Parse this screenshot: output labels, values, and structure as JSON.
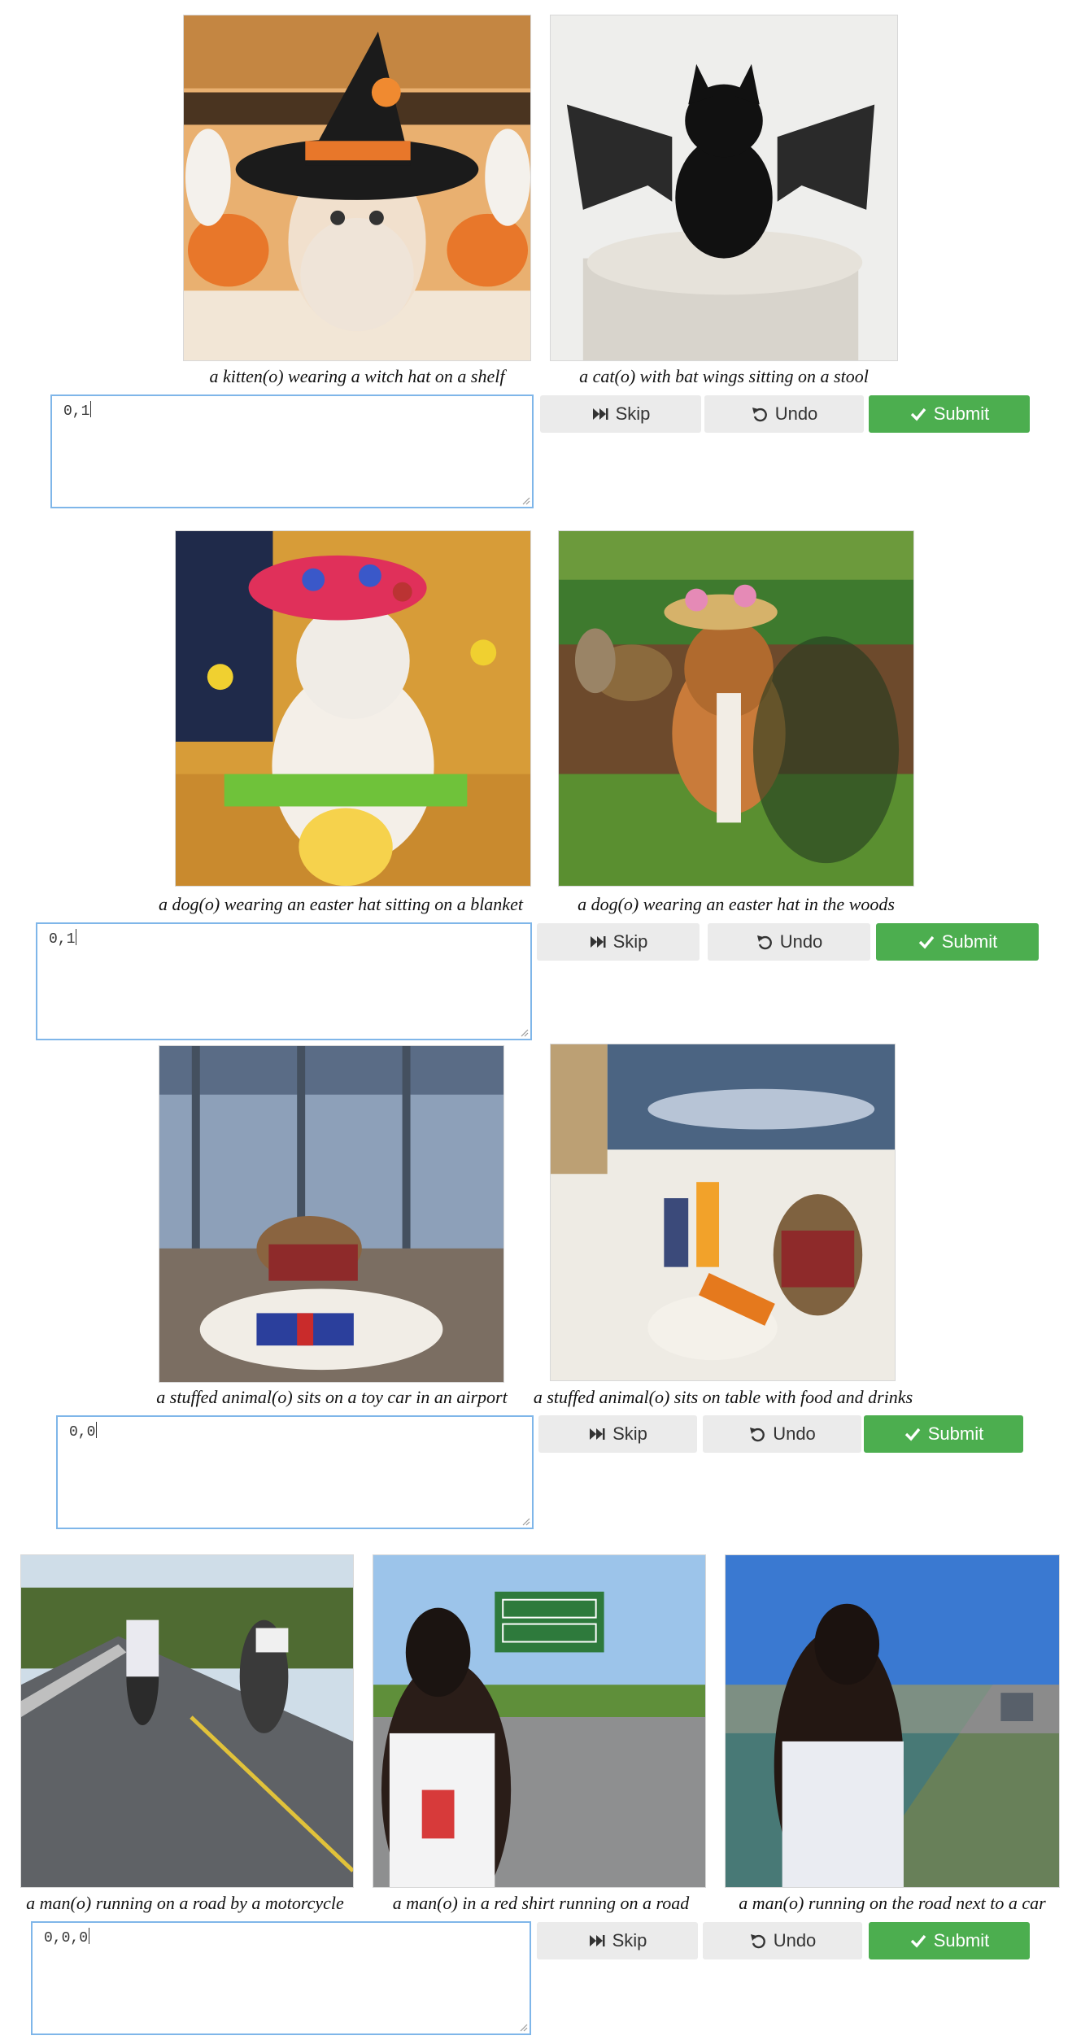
{
  "buttons": {
    "skip": "Skip",
    "undo": "Undo",
    "submit": "Submit"
  },
  "tasks": [
    {
      "captions": [
        "a kitten(o) wearing a witch hat on a shelf",
        "a cat(o) with bat wings sitting on a stool"
      ],
      "answer": "0,1",
      "images": [
        "kitten-witch-hat-photo",
        "black-cat-bat-wings-photo"
      ]
    },
    {
      "captions": [
        "a dog(o) wearing an easter hat sitting on a blanket",
        "a dog(o) wearing an easter hat in the woods"
      ],
      "answer": "0,1",
      "images": [
        "dog-easter-hat-blanket-photo",
        "beagle-easter-hat-woods-photo"
      ]
    },
    {
      "captions": [
        "a stuffed animal(o) sits on a toy car in an airport",
        "a stuffed animal(o) sits on table with food and drinks"
      ],
      "answer": "0,0",
      "images": [
        "stuffed-monkey-toy-car-photo",
        "stuffed-monkey-table-drinks-photo"
      ]
    },
    {
      "captions": [
        "a man(o) running on a road by a motorcycle",
        "a man(o) in a red shirt running on a road",
        "a man(o) running on the road next to a car"
      ],
      "answer": "0,0,0",
      "images": [
        "runner-motorcycle-photo",
        "runner-road-sign-photo",
        "runner-car-road-photo"
      ]
    }
  ],
  "colors": {
    "submit": "#4cae4f",
    "button_gray": "#ebebeb",
    "textarea_border": "#7fb6e9"
  },
  "icons": {
    "skip": "fast-forward-icon",
    "undo": "undo-icon",
    "submit": "checkmark-icon"
  }
}
